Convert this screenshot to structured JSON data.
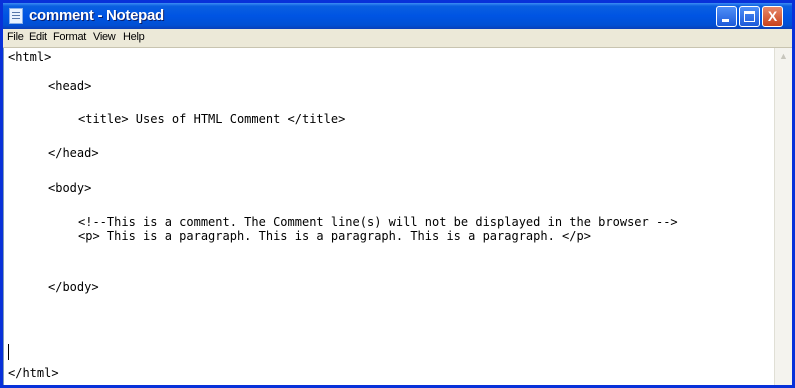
{
  "window": {
    "title": "comment - Notepad",
    "controls": {
      "minimize_icon": "minimize-icon",
      "maximize_icon": "maximize-icon",
      "close_glyph": "X"
    }
  },
  "menu": [
    "File",
    "Edit",
    "Format",
    "View",
    "Help"
  ],
  "editor": {
    "lines": [
      "<html>",
      "<head>",
      "<title> Uses of HTML Comment </title>",
      "</head>",
      "<body>",
      "<!--This is a comment. The Comment line(s) will not be displayed in the browser -->",
      "<p> This is a paragraph. This is a paragraph. This is a paragraph. </p>",
      "</body>",
      "</html>"
    ]
  },
  "scrollbar": {
    "up_arrow": "▲"
  },
  "colors": {
    "titlebar": "#0054e3",
    "window_border": "#0831d9",
    "close_button": "#c8421c",
    "menubar": "#ece9d8",
    "editor_bg": "#ffffff"
  }
}
